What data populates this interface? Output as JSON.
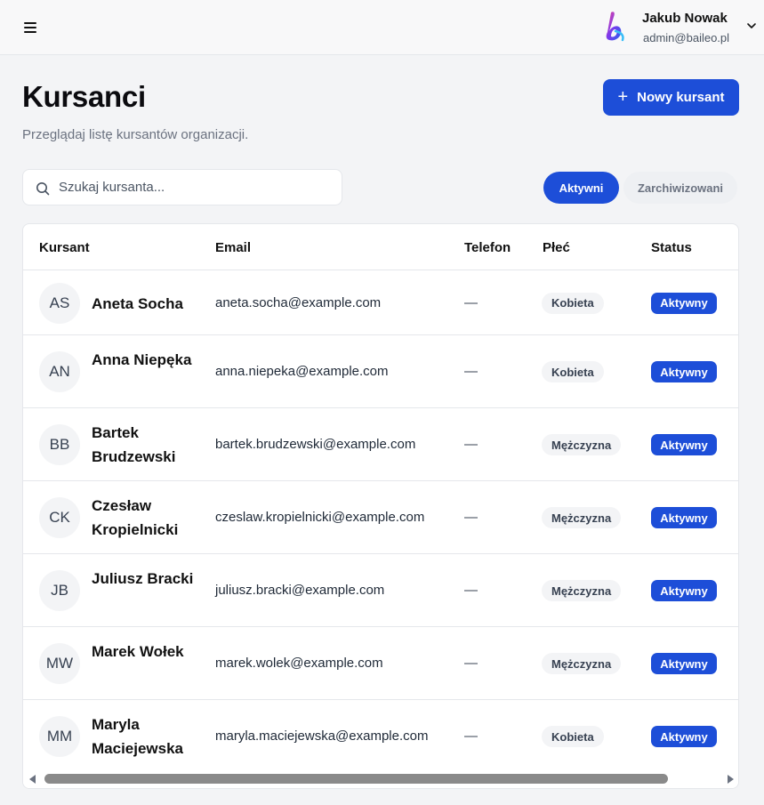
{
  "header": {
    "user_name": "Jakub Nowak",
    "user_email": "admin@baileo.pl",
    "logo_letter": "b"
  },
  "page": {
    "title": "Kursanci",
    "subtitle": "Przeglądaj listę kursantów organizacji.",
    "new_button_label": "Nowy kursant"
  },
  "search": {
    "placeholder": "Szukaj kursanta...",
    "value": ""
  },
  "tabs": [
    {
      "label": "Aktywni",
      "active": true
    },
    {
      "label": "Zarchiwizowani",
      "active": false
    }
  ],
  "table": {
    "columns": [
      "Kursant",
      "Email",
      "Telefon",
      "Płeć",
      "Status"
    ],
    "rows": [
      {
        "initials": "AS",
        "name": "Aneta Socha",
        "email": "aneta.socha@example.com",
        "phone": "—",
        "gender": "Kobieta",
        "status": "Aktywny"
      },
      {
        "initials": "AN",
        "name": "Anna Niepęka",
        "email": "anna.niepeka@example.com",
        "phone": "—",
        "gender": "Kobieta",
        "status": "Aktywny"
      },
      {
        "initials": "BB",
        "name": "Bartek Brudzewski",
        "email": "bartek.brudzewski@example.com",
        "phone": "—",
        "gender": "Mężczyzna",
        "status": "Aktywny"
      },
      {
        "initials": "CK",
        "name": "Czesław Kropielnicki",
        "email": "czeslaw.kropielnicki@example.com",
        "phone": "—",
        "gender": "Mężczyzna",
        "status": "Aktywny"
      },
      {
        "initials": "JB",
        "name": "Juliusz Bracki",
        "email": "juliusz.bracki@example.com",
        "phone": "—",
        "gender": "Mężczyzna",
        "status": "Aktywny"
      },
      {
        "initials": "MW",
        "name": "Marek Wołek",
        "email": "marek.wolek@example.com",
        "phone": "—",
        "gender": "Mężczyzna",
        "status": "Aktywny"
      },
      {
        "initials": "MM",
        "name": "Maryla Maciejewska",
        "email": "maryla.maciejewska@example.com",
        "phone": "—",
        "gender": "Kobieta",
        "status": "Aktywny"
      }
    ]
  },
  "colors": {
    "accent": "#1d4ed8",
    "background": "#f3f4f6"
  }
}
